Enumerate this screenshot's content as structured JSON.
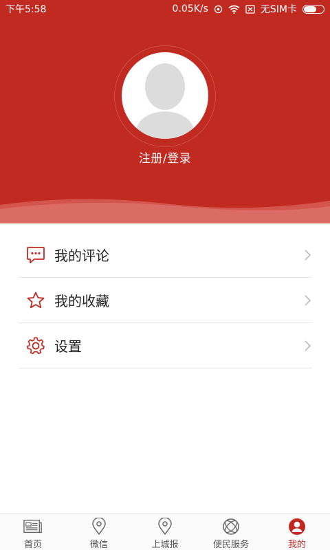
{
  "status_bar": {
    "time": "下午5:58",
    "speed": "0.05K/s",
    "sim": "无SIM卡"
  },
  "profile": {
    "login_label": "注册/登录"
  },
  "menu": {
    "items": [
      {
        "label": "我的评论",
        "icon": "comment-icon"
      },
      {
        "label": "我的收藏",
        "icon": "star-icon"
      },
      {
        "label": "设置",
        "icon": "gear-icon"
      }
    ]
  },
  "bottom_nav": {
    "items": [
      {
        "label": "首页",
        "icon": "newspaper-icon",
        "active": false
      },
      {
        "label": "微信",
        "icon": "location-pin-icon",
        "active": false
      },
      {
        "label": "上城报",
        "icon": "location-pin-icon",
        "active": false
      },
      {
        "label": "便民服务",
        "icon": "orbit-icon",
        "active": false
      },
      {
        "label": "我的",
        "icon": "user-icon",
        "active": true
      }
    ]
  },
  "colors": {
    "brand": "#c12a20",
    "inactive": "#555555"
  }
}
